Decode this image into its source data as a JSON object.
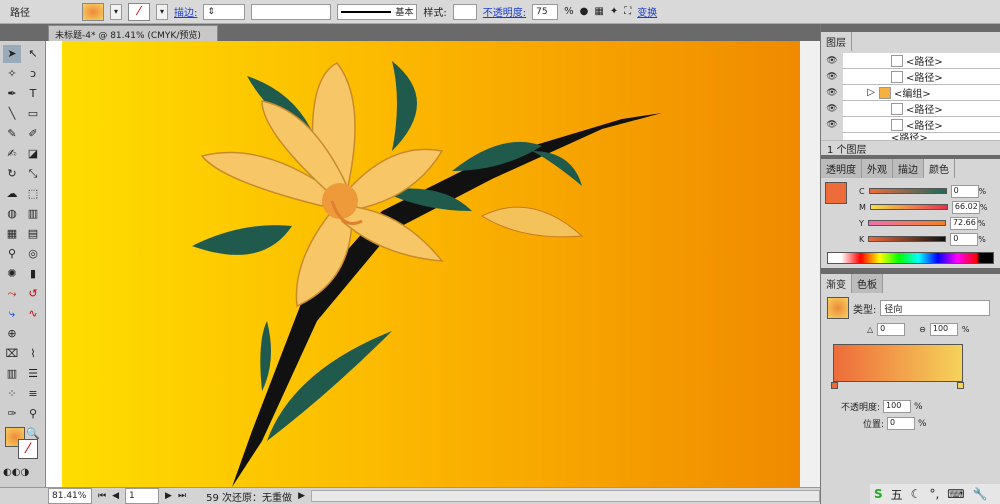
{
  "control_bar": {
    "selection": "路径",
    "stroke_label": "描边:",
    "stroke_profile": "基本",
    "style_label": "样式:",
    "opacity_label": "不透明度:",
    "opacity_value": "75",
    "opacity_unit": "%",
    "transform_label": "变换"
  },
  "document_tab": {
    "title": "未标题-4* @ 81.41% (CMYK/预览)",
    "close": "×"
  },
  "status_bar": {
    "zoom": "81.41%",
    "artboard": "1",
    "status": "59 次还原：无重做"
  },
  "layers_panel": {
    "title": "图层",
    "rows": [
      {
        "name": "<路径>"
      },
      {
        "name": "<路径>"
      },
      {
        "name": "<编组>"
      },
      {
        "name": "<路径>"
      },
      {
        "name": "<路径>"
      },
      {
        "name": "<路径>"
      }
    ],
    "footer": "1 个图层"
  },
  "color_panel": {
    "tabs": [
      "透明度",
      "外观",
      "描边",
      "颜色"
    ],
    "active_tab": "颜色",
    "fill_color": "#ee6b3a",
    "channels": [
      {
        "label": "C",
        "value": "0"
      },
      {
        "label": "M",
        "value": "66.02"
      },
      {
        "label": "Y",
        "value": "72.66"
      },
      {
        "label": "K",
        "value": "0"
      }
    ],
    "unit": "%"
  },
  "gradient_panel": {
    "tabs": [
      "渐变",
      "色板"
    ],
    "type_label": "类型:",
    "type_value": "径向",
    "angle_value": "0",
    "aspect_value": "100",
    "opacity_label": "不透明度:",
    "opacity_value": "100",
    "position_label": "位置:",
    "position_value": "0",
    "unit": "%",
    "start_color": "#ee6b3a",
    "end_color": "#f5d35a"
  },
  "taskbar": {
    "ime": "五"
  }
}
